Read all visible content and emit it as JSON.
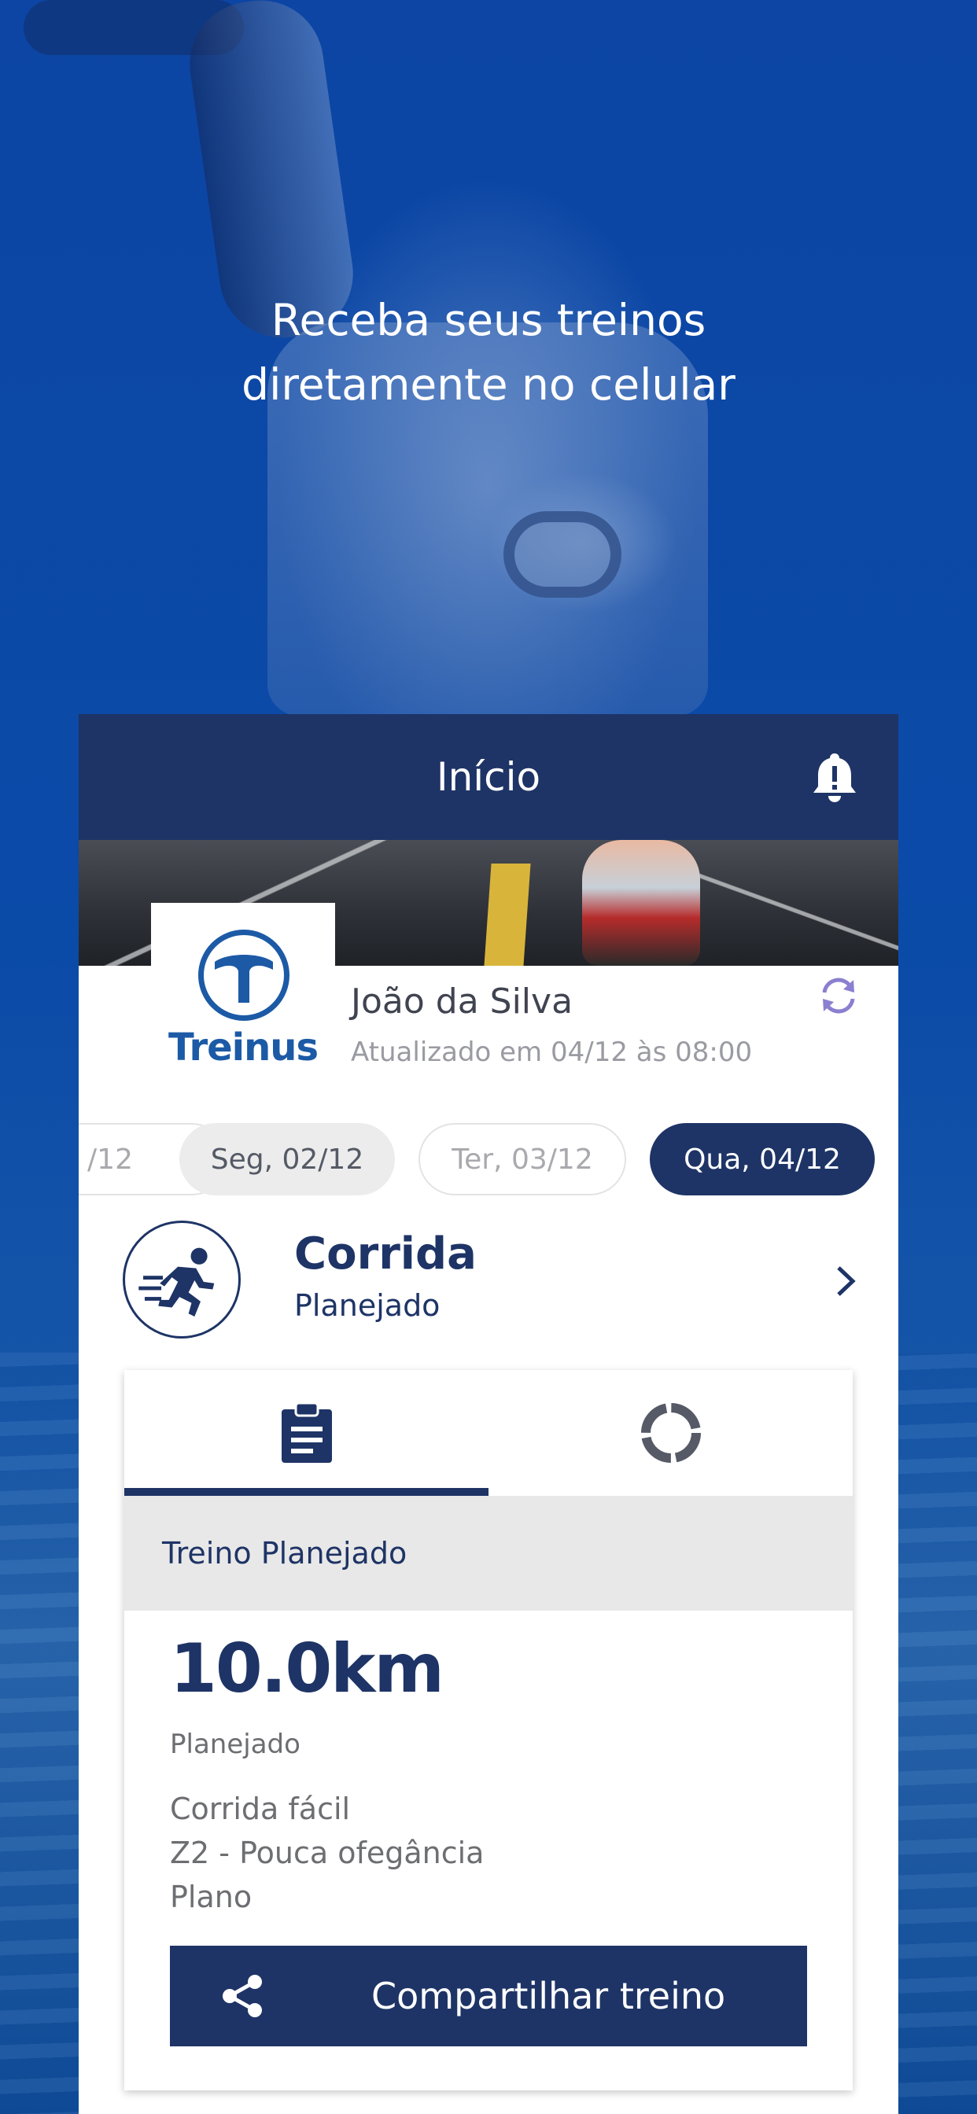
{
  "promo": {
    "headline_line1": "Receba seus treinos",
    "headline_line2": "diretamente no celular"
  },
  "appbar": {
    "title": "Início",
    "notification_icon": "bell-alert-icon"
  },
  "profile": {
    "logo_text": "Treinus",
    "name": "João da Silva",
    "updated": "Atualizado em 04/12 às 08:00",
    "refresh_icon": "refresh-icon"
  },
  "dates": [
    {
      "label": "/12",
      "state": "inactive"
    },
    {
      "label": "Seg, 02/12",
      "state": "past"
    },
    {
      "label": "Ter, 03/12",
      "state": "inactive"
    },
    {
      "label": "Qua, 04/12",
      "state": "selected"
    }
  ],
  "activity": {
    "icon": "running-icon",
    "title": "Corrida",
    "status": "Planejado"
  },
  "workout_card": {
    "tabs": [
      {
        "icon": "clipboard-icon",
        "selected": true
      },
      {
        "icon": "progress-ring-icon",
        "selected": false
      }
    ],
    "section_title": "Treino Planejado",
    "distance": "10.0km",
    "distance_label": "Planejado",
    "details": [
      "Corrida fácil",
      "Z2 - Pouca ofegância",
      "Plano"
    ],
    "share_label": "Compartilhar treino"
  },
  "colors": {
    "primary": "#1e3466",
    "logo_blue": "#1c5aa6",
    "refresh_purple": "#8a7fd0"
  }
}
